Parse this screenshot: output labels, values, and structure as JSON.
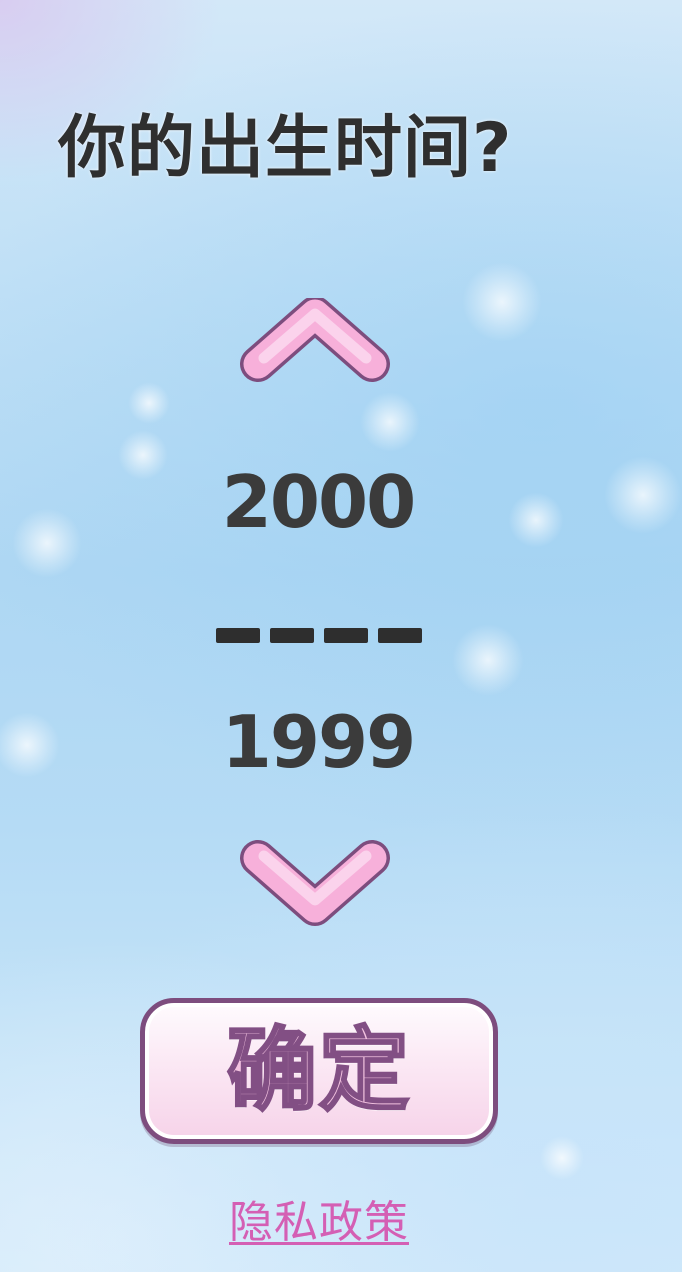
{
  "title": "你的出生时间?",
  "year_picker": {
    "next_year": "2000",
    "selected_year": "1999",
    "increase_icon": "chevron-up-icon",
    "decrease_icon": "chevron-down-icon",
    "separator_dash_count": 4
  },
  "confirm_button": {
    "label": "确定"
  },
  "privacy_link": {
    "label": "隐私政策"
  },
  "colors": {
    "title_text": "#2f2f2f",
    "year_text": "#3b3b3b",
    "arrow_fill": "#f7b0da",
    "arrow_outline": "#7d4d7e",
    "button_text": "#f3c3e0",
    "button_outline": "#824f84",
    "link_text": "#d45fb4",
    "background": "#b5dbf5"
  }
}
